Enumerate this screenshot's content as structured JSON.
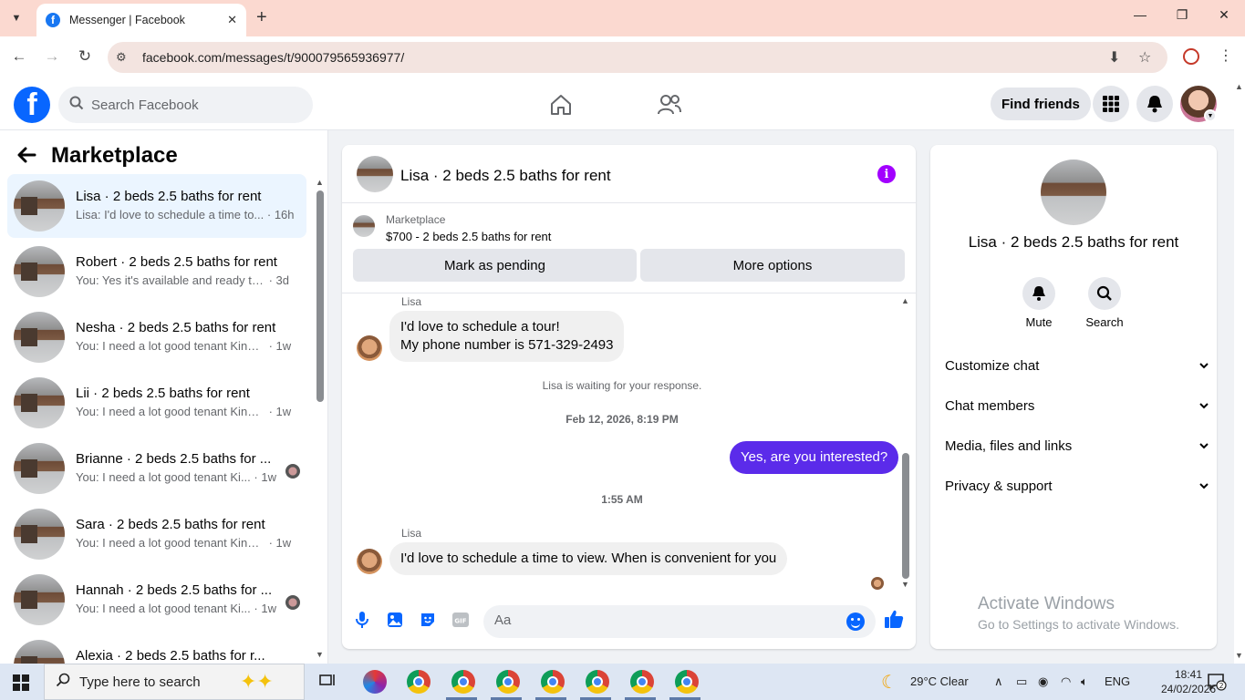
{
  "browser": {
    "tab_title": "Messenger | Facebook",
    "tab_close": "✕",
    "new_tab": "+",
    "url": "facebook.com/messages/t/900079565936977/",
    "window_controls": [
      "—",
      "❐",
      "✕"
    ]
  },
  "fb_header": {
    "search_placeholder": "Search Facebook",
    "find_friends_label": "Find friends"
  },
  "sidebar": {
    "title": "Marketplace",
    "conversations": [
      {
        "name": "Lisa · 2 beds 2.5 baths for rent",
        "snippet": "Lisa: I'd love to schedule a time to...",
        "time": " · 16h",
        "active": true
      },
      {
        "name": "Robert · 2 beds 2.5 baths for rent",
        "snippet": "You: Yes it's available and ready to ...",
        "time": " · 3d"
      },
      {
        "name": "Nesha · 2 beds 2.5 baths for rent",
        "snippet": "You: I need a lot good tenant Kindl...",
        "time": " · 1w"
      },
      {
        "name": "Lii · 2 beds 2.5 baths for rent",
        "snippet": "You: I need a lot good tenant Kindl...",
        "time": " · 1w"
      },
      {
        "name": "Brianne · 2 beds 2.5 baths for ...",
        "snippet": "You: I need a lot good tenant Ki...",
        "time": " · 1w"
      },
      {
        "name": "Sara · 2 beds 2.5 baths for rent",
        "snippet": "You: I need a lot good tenant Kindl...",
        "time": " · 1w"
      },
      {
        "name": "Hannah · 2 beds 2.5 baths for ...",
        "snippet": "You: I need a lot good tenant Ki...",
        "time": " · 1w"
      },
      {
        "name": "Alexia · 2 beds 2.5 baths for r...",
        "snippet": "",
        "time": ""
      }
    ]
  },
  "chat": {
    "title": "Lisa · 2 beds 2.5 baths for rent",
    "marketplace_label": "Marketplace",
    "listing": "$700 - 2 beds 2.5 baths for rent",
    "mark_pending": "Mark as pending",
    "more_options": "More options",
    "sender1": "Lisa",
    "msg1_line1": "I'd love to schedule a tour!",
    "msg1_line2": "My phone number is 571-329-2493",
    "waiting": "Lisa is waiting for your response.",
    "timestamp1": "Feb 12, 2026, 8:19 PM",
    "msg_out": "Yes, are you interested?",
    "timestamp2": "1:55 AM",
    "sender2": "Lisa",
    "msg2": "I'd love to schedule a time to view. When is convenient for you",
    "composer_placeholder": "Aa",
    "gif_label": "GIF"
  },
  "info_panel": {
    "name": "Lisa · 2 beds 2.5 baths for rent",
    "mute_label": "Mute",
    "search_label": "Search",
    "sections": [
      "Customize chat",
      "Chat members",
      "Media, files and links",
      "Privacy & support"
    ]
  },
  "watermark": {
    "line1": "Activate Windows",
    "line2": "Go to Settings to activate Windows."
  },
  "taskbar": {
    "search_text": "Type here to search",
    "weather": "29°C  Clear",
    "lang": "ENG",
    "time": "18:41",
    "date": "24/02/2026",
    "notif_count": "2"
  },
  "colors": {
    "fb_blue": "#0866ff",
    "outgoing_bubble": "#5b2bea",
    "info_icon": "#a200ff",
    "tab_strip": "#fbd9d0"
  }
}
